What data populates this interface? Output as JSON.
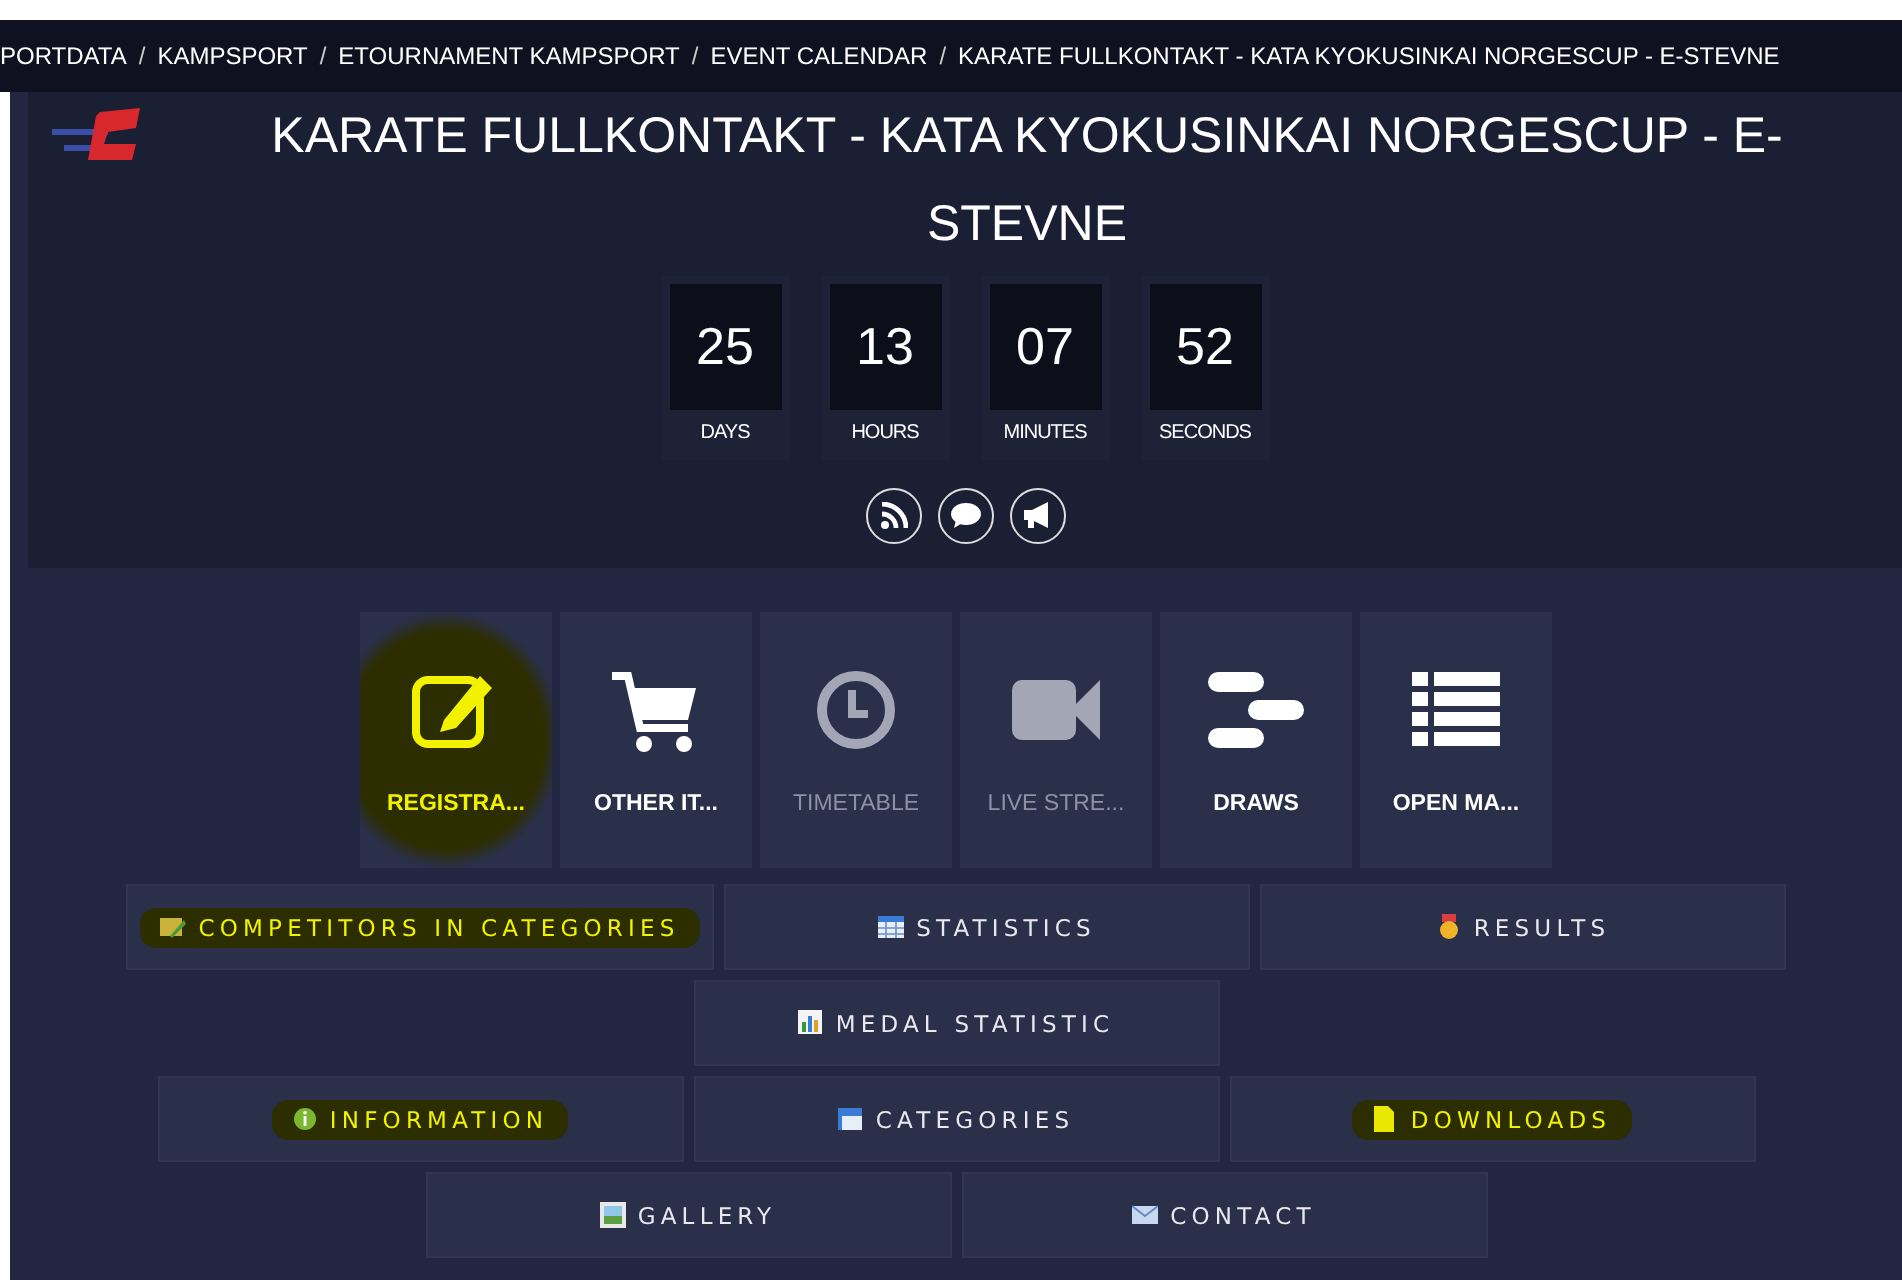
{
  "breadcrumb_separator": "/",
  "breadcrumb": [
    "PORTDATA",
    "KAMPSPORT",
    "ETOURNAMENT KAMPSPORT",
    "EVENT CALENDAR",
    "KARATE FULLKONTAKT - KATA KYOKUSINKAI NORGESCUP - E-STEVNE"
  ],
  "title": "KARATE FULLKONTAKT - KATA KYOKUSINKAI NORGESCUP - E-STEVNE",
  "countdown": [
    {
      "value": "25",
      "label": "DAYS"
    },
    {
      "value": "13",
      "label": "HOURS"
    },
    {
      "value": "07",
      "label": "MINUTES"
    },
    {
      "value": "52",
      "label": "SECONDS"
    }
  ],
  "tiles": [
    {
      "label": "REGISTRA...",
      "disabled": false,
      "highlighted": true
    },
    {
      "label": "OTHER IT...",
      "disabled": false,
      "highlighted": false
    },
    {
      "label": "TIMETABLE",
      "disabled": true,
      "highlighted": false
    },
    {
      "label": "LIVE STRE...",
      "disabled": true,
      "highlighted": false
    },
    {
      "label": "DRAWS",
      "disabled": false,
      "highlighted": false
    },
    {
      "label": "OPEN MA...",
      "disabled": false,
      "highlighted": false
    }
  ],
  "button_rows": [
    [
      {
        "label": "COMPETITORS IN CATEGORIES",
        "highlighted": true
      },
      {
        "label": "STATISTICS",
        "highlighted": false
      },
      {
        "label": "RESULTS",
        "highlighted": false
      }
    ],
    [
      {
        "label": "MEDAL STATISTIC",
        "highlighted": false
      }
    ],
    [
      {
        "label": "INFORMATION",
        "highlighted": true
      },
      {
        "label": "CATEGORIES",
        "highlighted": false
      },
      {
        "label": "DOWNLOADS",
        "highlighted": true
      }
    ],
    [
      {
        "label": "GALLERY",
        "highlighted": false
      },
      {
        "label": "CONTACT",
        "highlighted": false
      }
    ]
  ]
}
